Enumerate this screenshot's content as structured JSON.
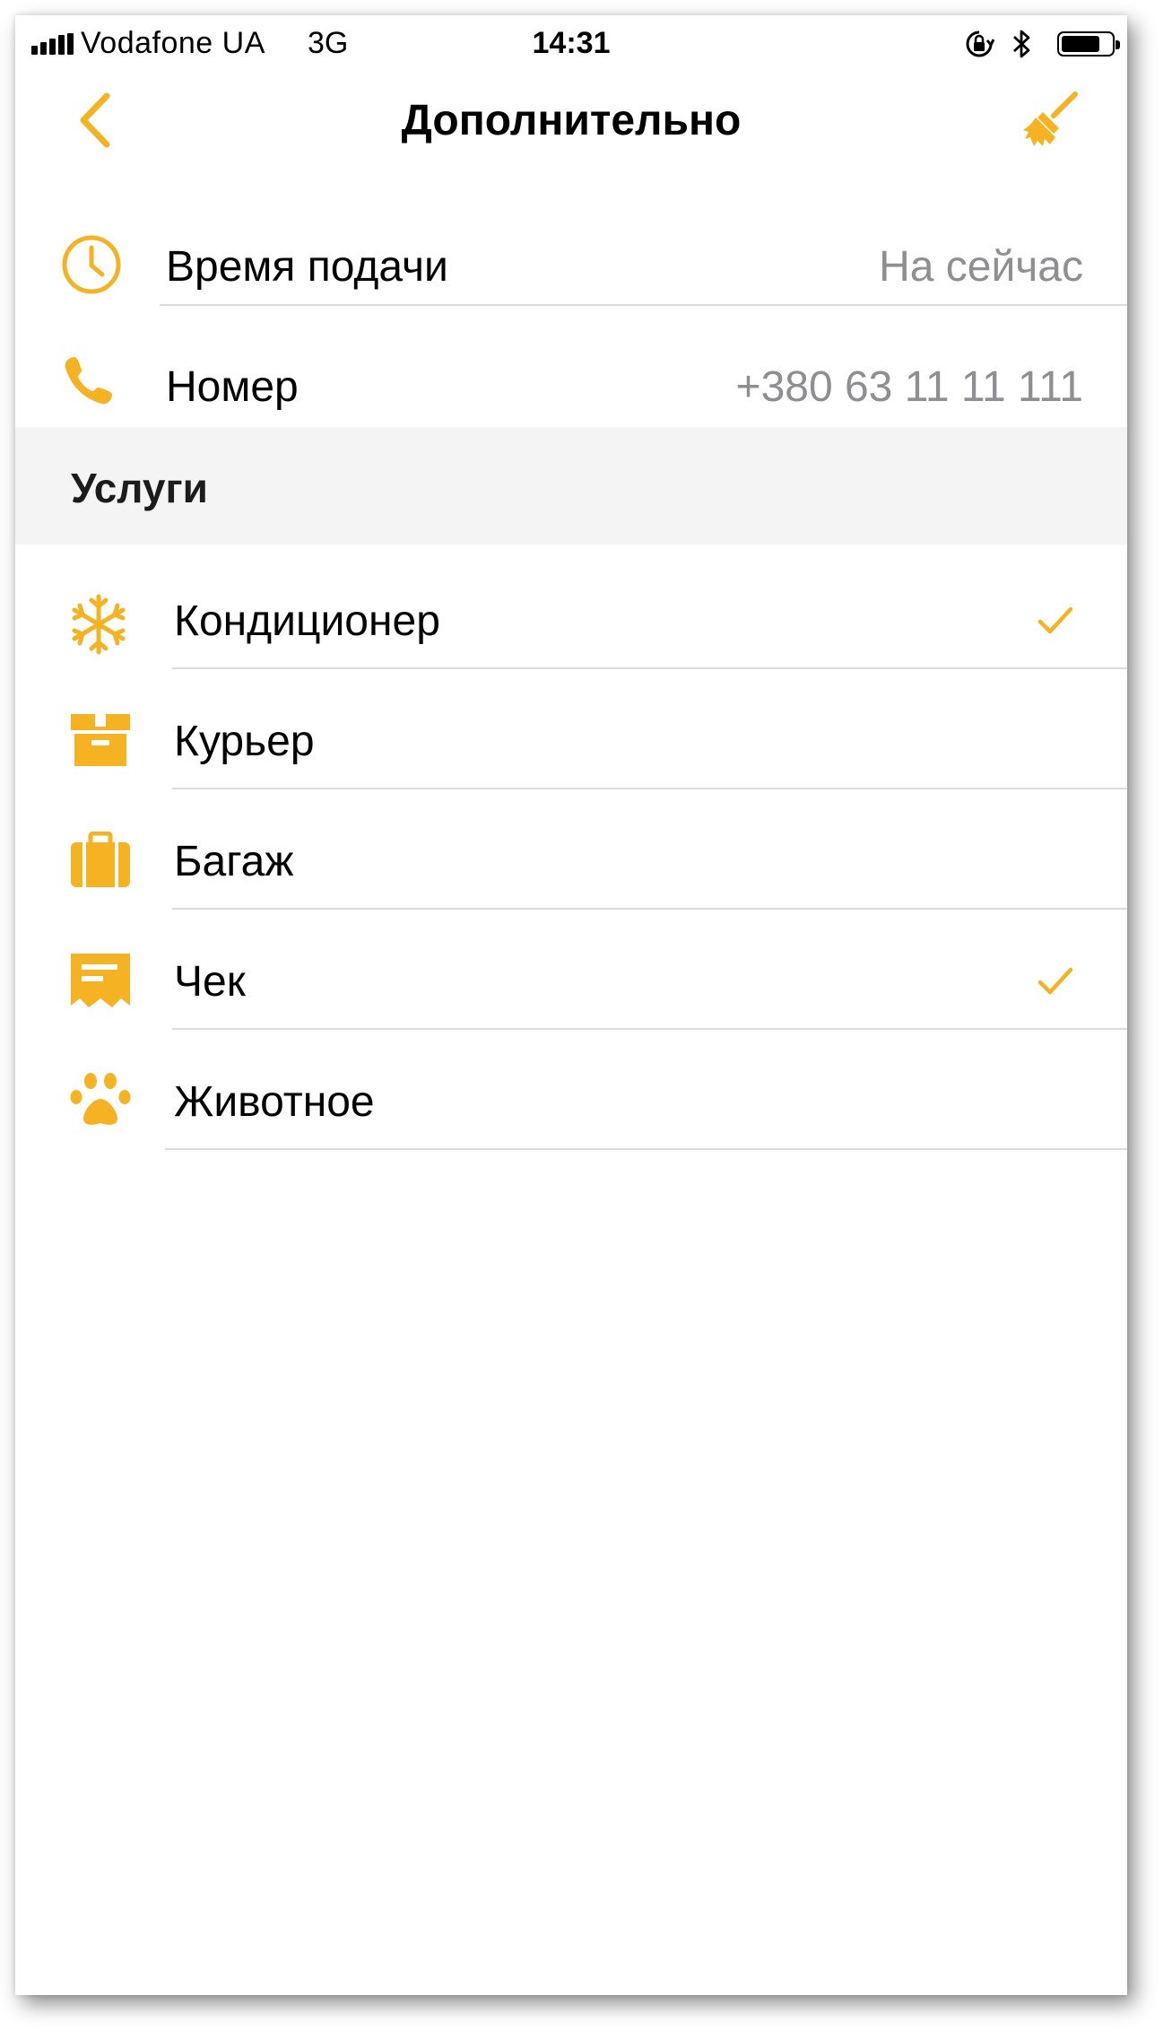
{
  "status_bar": {
    "carrier": "Vodafone UA",
    "network": "3G",
    "time": "14:31",
    "icons": [
      "signal-icon",
      "orientation-lock-icon",
      "bluetooth-icon",
      "battery-icon"
    ]
  },
  "nav": {
    "title": "Дополнительно",
    "back_icon": "chevron-left-icon",
    "clear_icon": "broom-icon"
  },
  "order": {
    "time_label": "Время подачи",
    "time_value": "На сейчас",
    "phone_label": "Номер",
    "phone_value": "+380 63 11 11 111"
  },
  "services": {
    "header": "Услуги",
    "items": [
      {
        "label": "Кондиционер",
        "icon": "snowflake-icon",
        "checked": true
      },
      {
        "label": "Курьер",
        "icon": "box-icon",
        "checked": false
      },
      {
        "label": "Багаж",
        "icon": "suitcase-icon",
        "checked": false
      },
      {
        "label": "Чек",
        "icon": "receipt-icon",
        "checked": true
      },
      {
        "label": "Животное",
        "icon": "paw-icon",
        "checked": false
      }
    ]
  },
  "colors": {
    "accent": "#F5B323",
    "secondary_text": "#8E8E93",
    "section_bg": "#F4F4F4",
    "separator": "#DCDCDC"
  }
}
